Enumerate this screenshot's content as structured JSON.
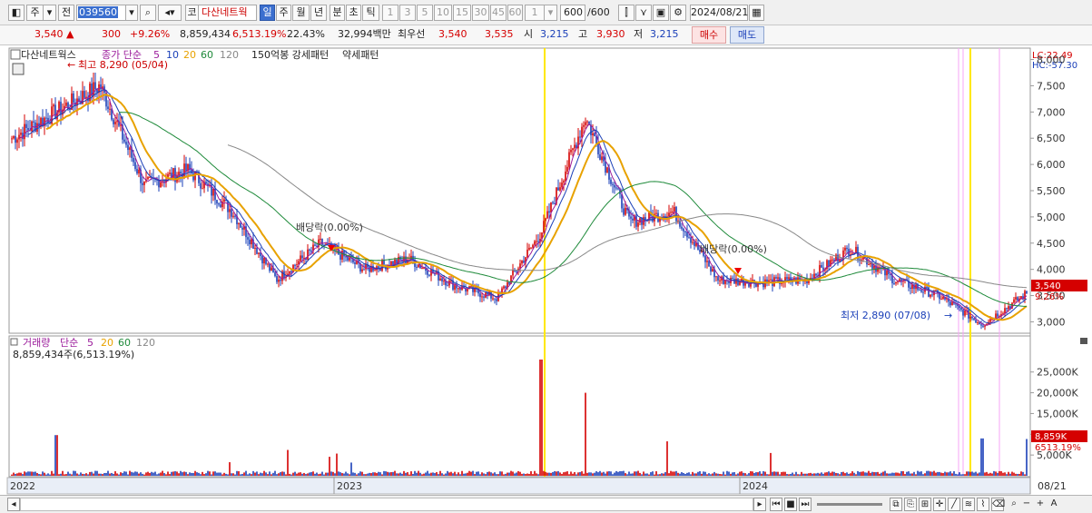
{
  "toolbar": {
    "market_code": "주",
    "prev_label": "전",
    "stock_code": "039560",
    "stock_name": "다산네트웍",
    "code_prefix": "코",
    "periods": [
      "일",
      "주",
      "월",
      "년",
      "분",
      "초",
      "틱"
    ],
    "active_period": "일",
    "intervals": [
      "1",
      "3",
      "5",
      "10",
      "15",
      "30",
      "45",
      "60"
    ],
    "interval_value": "1",
    "count_value": "600",
    "count_total": "/600",
    "date": "2024/08/21"
  },
  "quote": {
    "price": "3,540",
    "change_arrow": "▲",
    "change": "300",
    "change_pct": "+9.26%",
    "volume": "8,859,434",
    "volume_ratio": "6,513.19%",
    "turnover": "22.43%",
    "amount": "32,994백만",
    "best_bid_label": "최우선",
    "best_ask": "3,540",
    "best_bid": "3,535",
    "open_label": "시",
    "open": "3,215",
    "high_label": "고",
    "high": "3,930",
    "low_label": "저",
    "low": "3,215",
    "buy_label": "매수",
    "sell_label": "매도"
  },
  "price_panel": {
    "stock_tag": "다산네트웍스",
    "ma_title": "종가 단순",
    "ma_periods": [
      "5",
      "10",
      "20",
      "60",
      "120"
    ],
    "pattern_title": "150억봉 강세패턴",
    "weak_pattern": "약세패턴",
    "lc": "LC:22.49",
    "hc": "HC:-57.30",
    "y_ticks": [
      "8,000",
      "7,500",
      "7,000",
      "6,500",
      "6,000",
      "5,500",
      "5,000",
      "4,500",
      "4,000",
      "3,500",
      "3,000"
    ],
    "last_price_tag": "3,540",
    "last_pct_tag": "9.26%",
    "annotations": {
      "high": "최고 8,290 (05/04)",
      "low": "최저 2,890 (07/08)",
      "dividend_1": "배당락(0.00%)",
      "dividend_2": "배당락(0.00%)"
    }
  },
  "volume_panel": {
    "title": "거래량",
    "ma_title": "단순",
    "ma_periods": [
      "5",
      "20",
      "60",
      "120"
    ],
    "summary": "8,859,434주(6,513.19%)",
    "y_ticks": [
      "25,000K",
      "20,000K",
      "15,000K",
      "10,000K",
      "5,000K"
    ],
    "last_vol_tag": "8,859K",
    "last_pct_tag": "6513.19%"
  },
  "x_axis": {
    "labels": [
      "2022",
      "2023",
      "2024"
    ],
    "right_date": "08/21"
  },
  "colors": {
    "up": "#d50000",
    "down": "#1a3fb8",
    "ma5": "#9b1c9b",
    "ma10": "#1a3fb8",
    "ma20": "#e8a200",
    "ma60": "#1e8a3a",
    "ma120": "#888888",
    "marker": "#ffe800"
  },
  "chart_data": {
    "type": "line",
    "title": "다산네트웍스",
    "x": [
      "2022-01",
      "2022-03",
      "2022-05",
      "2022-06",
      "2022-08",
      "2022-09",
      "2022-10",
      "2022-12",
      "2023-01",
      "2023-03",
      "2023-05",
      "2023-06",
      "2023-07",
      "2023-07",
      "2023-08",
      "2023-09",
      "2023-10",
      "2023-12",
      "2024-01",
      "2024-03",
      "2024-04",
      "2024-06",
      "2024-07",
      "2024-08"
    ],
    "series": [
      {
        "name": "종가",
        "values": [
          6500,
          7000,
          7500,
          5600,
          5900,
          5100,
          3800,
          4500,
          4000,
          4200,
          3700,
          3450,
          4700,
          6900,
          4900,
          5100,
          3800,
          3750,
          3800,
          4400,
          3800,
          3500,
          2950,
          3540
        ]
      }
    ],
    "ylim": [
      2800,
      8200
    ],
    "volume_values_k": [
      300,
      9800,
      500,
      300,
      400,
      600,
      400,
      500,
      400,
      300,
      600,
      400,
      28000,
      20000,
      1000,
      1000,
      500,
      500,
      500,
      600,
      700,
      900,
      9000,
      8859
    ],
    "volume_ylim_k": [
      0,
      28000
    ]
  }
}
